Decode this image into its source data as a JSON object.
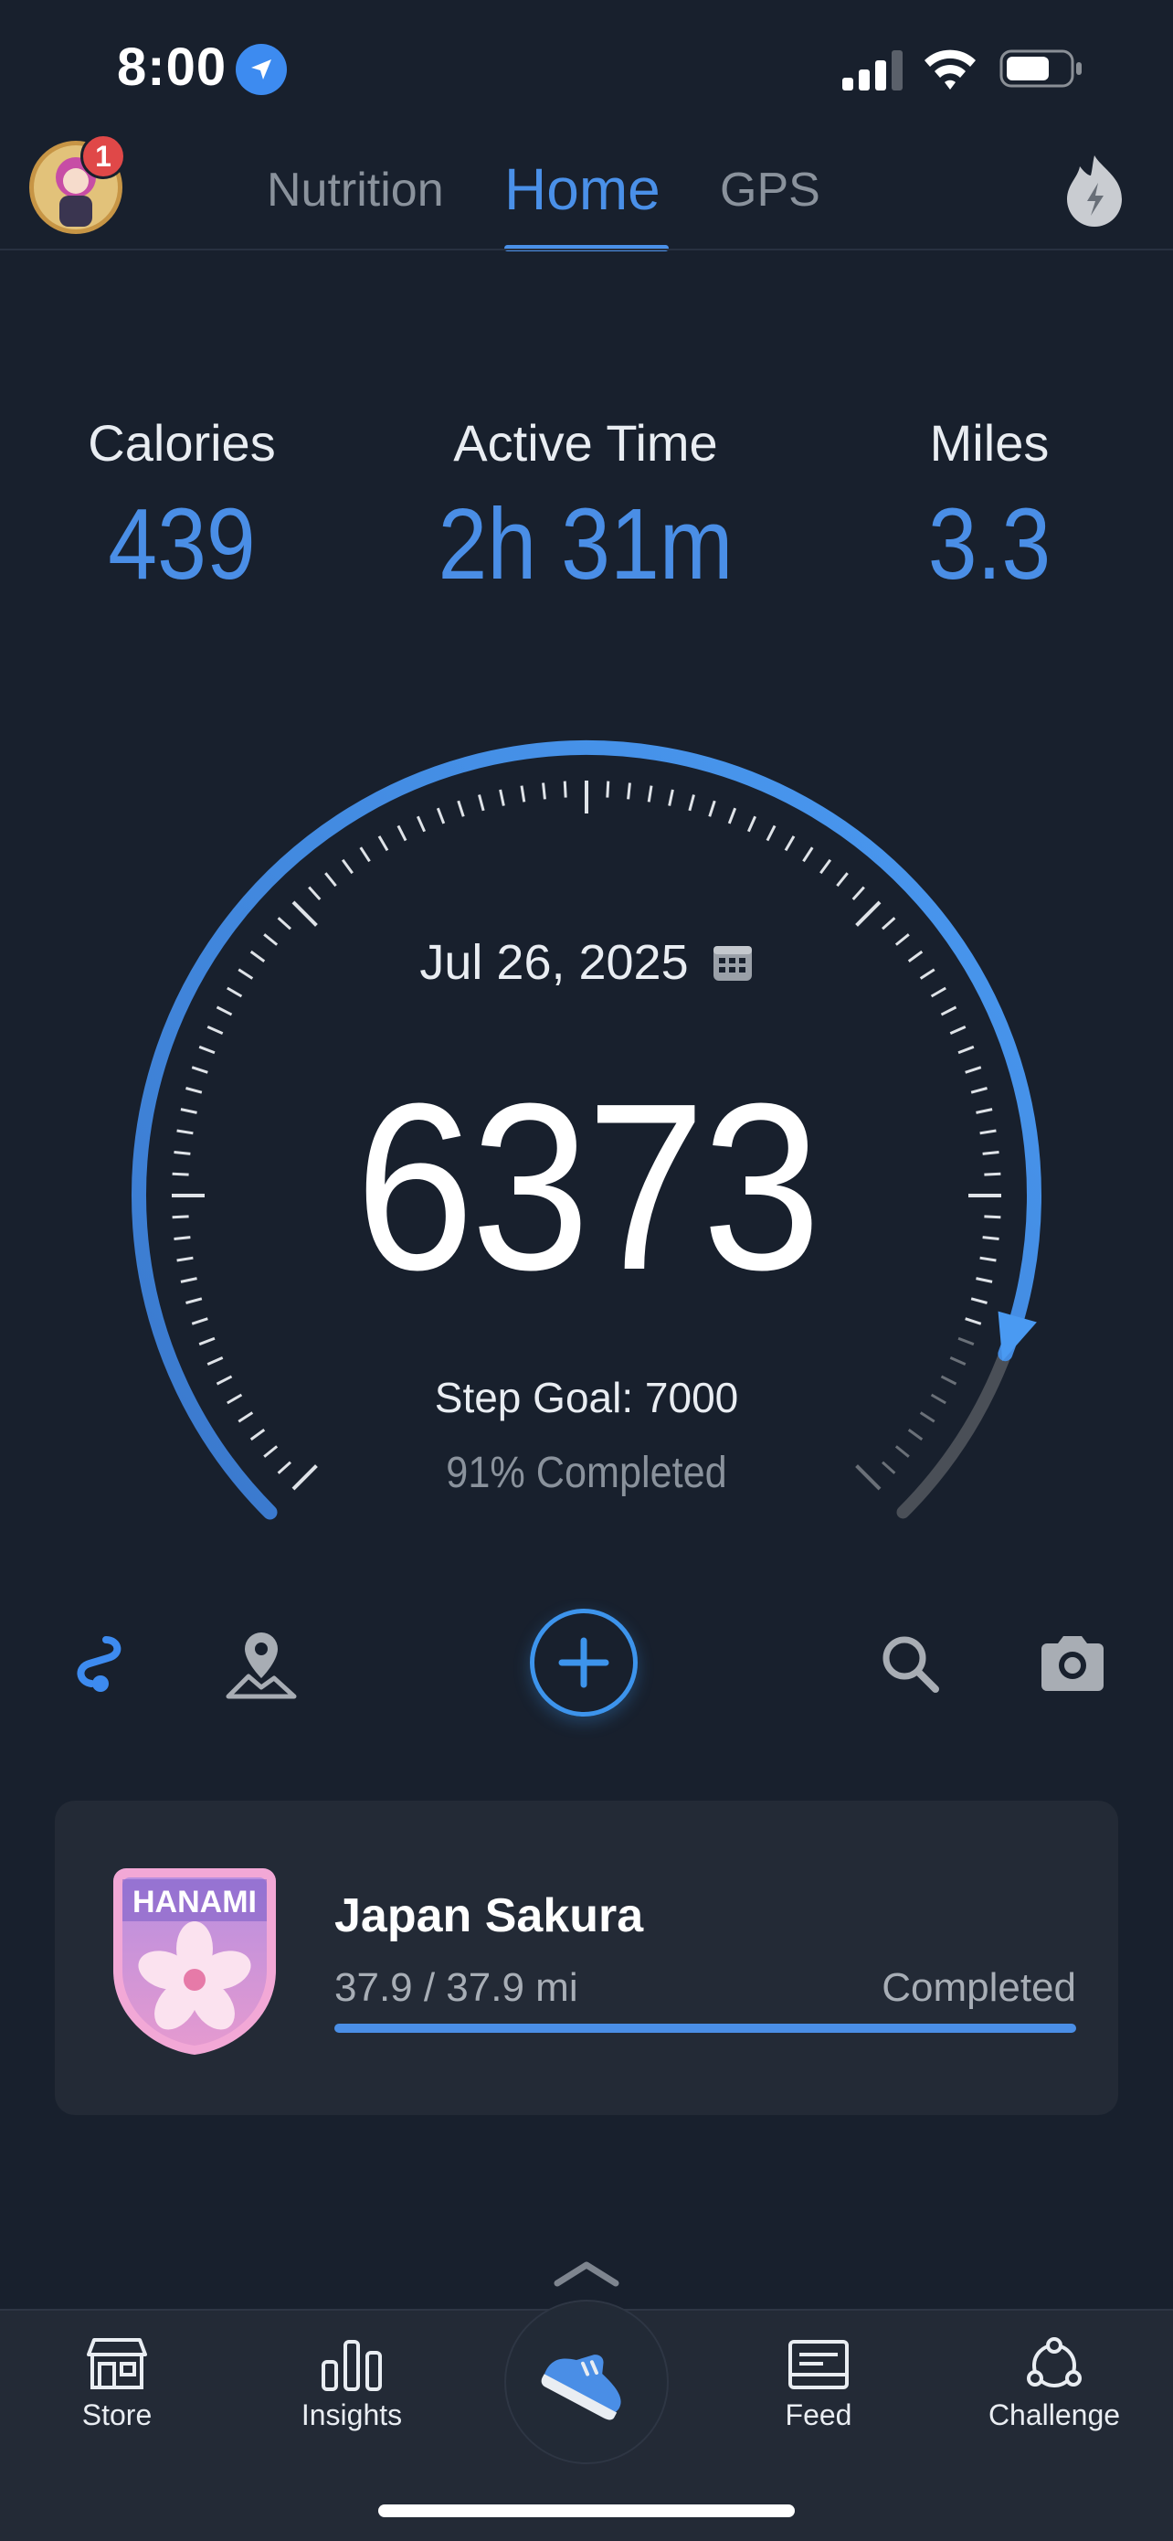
{
  "status_bar": {
    "time": "8:00"
  },
  "nav": {
    "notification_count": "1",
    "tabs": [
      {
        "label": "Nutrition",
        "active": false
      },
      {
        "label": "Home",
        "active": true
      },
      {
        "label": "GPS",
        "active": false
      }
    ]
  },
  "stats": [
    {
      "label": "Calories",
      "value": "439"
    },
    {
      "label": "Active Time",
      "value": "2h 31m"
    },
    {
      "label": "Miles",
      "value": "3.3"
    }
  ],
  "gauge": {
    "date": "Jul 26, 2025",
    "steps": "6373",
    "goal_text": "Step Goal: 7000",
    "completed_text": "91% Completed",
    "progress_fraction": 0.91
  },
  "actions": [
    "route-icon",
    "map-pin-icon",
    "add-icon",
    "search-icon",
    "camera-icon"
  ],
  "challenge": {
    "badge_text": "HANAMI",
    "title": "Japan Sakura",
    "distance": "37.9 / 37.9 mi",
    "status": "Completed",
    "progress_fraction": 1.0
  },
  "tabbar": {
    "items": [
      {
        "label": "Store",
        "icon": "store-icon"
      },
      {
        "label": "Insights",
        "icon": "bar-chart-icon"
      },
      {
        "label": "",
        "icon": "shoe-icon"
      },
      {
        "label": "Feed",
        "icon": "feed-icon"
      },
      {
        "label": "Challenge",
        "icon": "challenge-icon"
      }
    ]
  },
  "colors": {
    "background": "#18202d",
    "accent": "#4a8ee6",
    "card": "#232a36",
    "badge": "#e04848"
  }
}
